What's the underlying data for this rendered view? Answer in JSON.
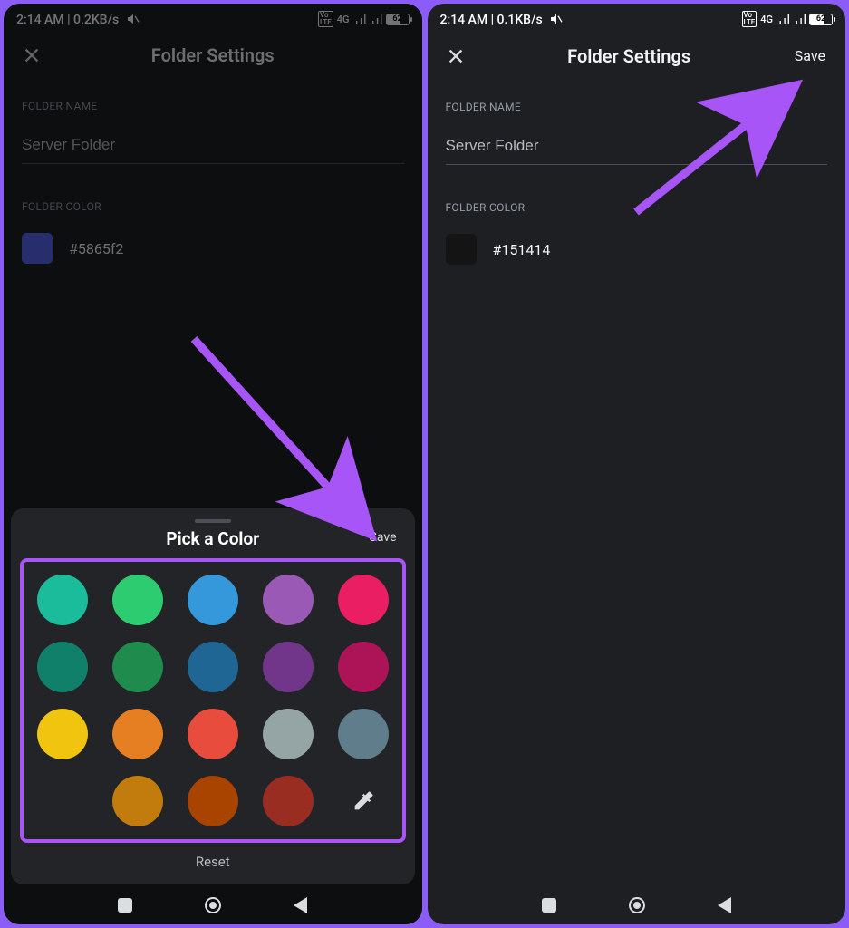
{
  "left": {
    "status": {
      "time": "2:14 AM",
      "speed": "0.2KB/s",
      "net": "4G",
      "batt": "62"
    },
    "header": {
      "title": "Folder Settings"
    },
    "folder_name_label": "FOLDER NAME",
    "folder_name_value": "Server Folder",
    "folder_color_label": "FOLDER COLOR",
    "folder_color_hex": "#5865f2",
    "sheet": {
      "title": "Pick a Color",
      "save": "Save",
      "reset": "Reset",
      "colors": [
        "#1abc9c",
        "#2ecc71",
        "#3498db",
        "#9b59b6",
        "#e91e63",
        "#11806a",
        "#1f8b4c",
        "#206694",
        "#71368a",
        "#ad1457",
        "#f1c40f",
        "#e67e22",
        "#e74c3c",
        "#95a5a6",
        "#607d8b",
        "#c27c0e",
        "#a84300",
        "#992d22"
      ]
    }
  },
  "right": {
    "status": {
      "time": "2:14 AM",
      "speed": "0.1KB/s",
      "net": "4G",
      "batt": "62"
    },
    "header": {
      "title": "Folder Settings",
      "save": "Save"
    },
    "folder_name_label": "FOLDER NAME",
    "folder_name_value": "Server Folder",
    "folder_color_label": "FOLDER COLOR",
    "folder_color_hex": "#151414"
  }
}
